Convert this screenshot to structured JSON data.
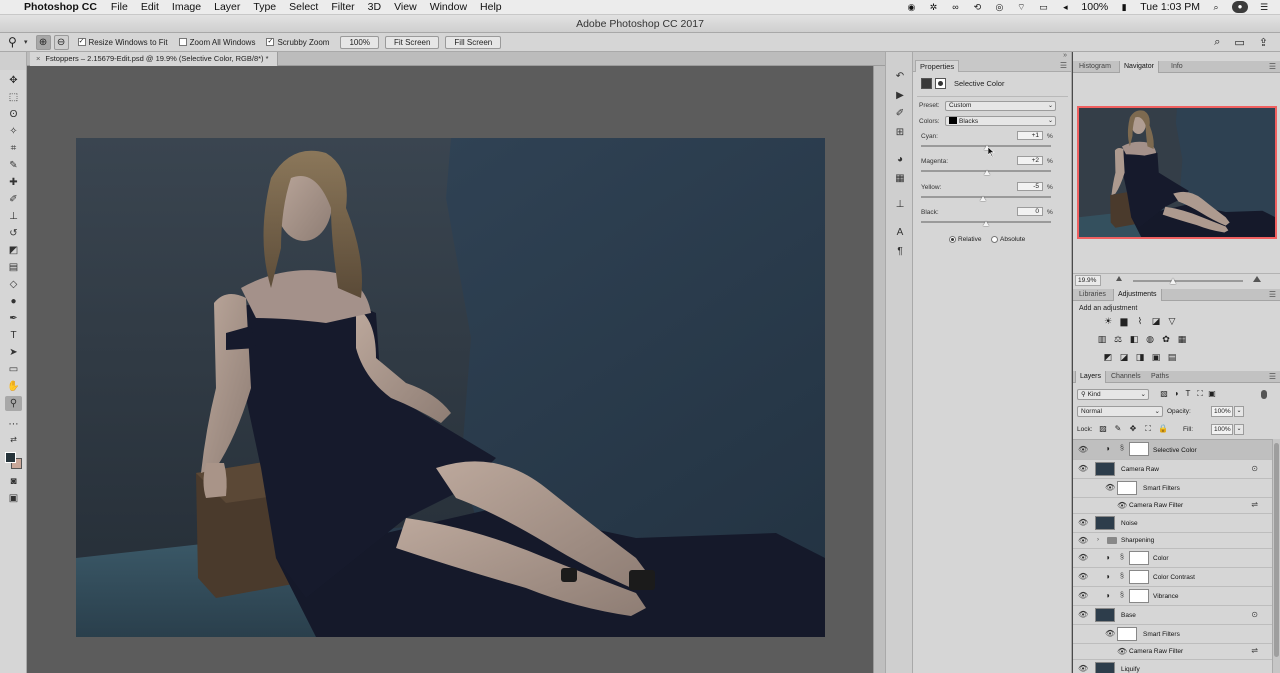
{
  "menubar": {
    "app": "Photoshop CC",
    "items": [
      "File",
      "Edit",
      "Image",
      "Layer",
      "Type",
      "Select",
      "Filter",
      "3D",
      "View",
      "Window",
      "Help"
    ],
    "battery": "100%",
    "clock": "Tue 1:03 PM"
  },
  "window": {
    "title": "Adobe Photoshop CC 2017"
  },
  "options": {
    "resize_windows": "Resize Windows to Fit",
    "zoom_all": "Zoom All Windows",
    "scrubby": "Scrubby Zoom",
    "btn_100": "100%",
    "btn_fit": "Fit Screen",
    "btn_fill": "Fill Screen"
  },
  "document": {
    "tab": "Fstoppers – 2.15679-Edit.psd @ 19.9% (Selective Color, RGB/8*) *"
  },
  "properties": {
    "tab": "Properties",
    "title": "Selective Color",
    "preset_label": "Preset:",
    "preset_value": "Custom",
    "colors_label": "Colors:",
    "colors_value": "Blacks",
    "sliders": [
      {
        "label": "Cyan:",
        "value": "+1",
        "pos": 0.505
      },
      {
        "label": "Magenta:",
        "value": "+2",
        "pos": 0.51
      },
      {
        "label": "Yellow:",
        "value": "-5",
        "pos": 0.475
      },
      {
        "label": "Black:",
        "value": "0",
        "pos": 0.5
      }
    ],
    "pct": "%",
    "relative": "Relative",
    "absolute": "Absolute"
  },
  "histogram_panel": {
    "tabs": [
      "Histogram",
      "Navigator",
      "Info"
    ],
    "zoom": "19.9%",
    "zoom_slider_pos": 0.36
  },
  "adjustments_panel": {
    "tabs": [
      "Libraries",
      "Adjustments"
    ],
    "add_label": "Add an adjustment"
  },
  "layers_panel": {
    "tabs": [
      "Layers",
      "Channels",
      "Paths"
    ],
    "kind": "Kind",
    "blend_mode": "Normal",
    "opacity_label": "Opacity:",
    "opacity": "100%",
    "lock_label": "Lock:",
    "fill_label": "Fill:",
    "fill": "100%",
    "layers": [
      {
        "name": "Selective Color"
      },
      {
        "name": "Camera Raw"
      },
      {
        "name": "Smart Filters"
      },
      {
        "name": "Camera Raw Filter"
      },
      {
        "name": "Noise"
      },
      {
        "name": "Sharpening"
      },
      {
        "name": "Color"
      },
      {
        "name": "Color Contrast"
      },
      {
        "name": "Vibrance"
      },
      {
        "name": "Base"
      },
      {
        "name": "Smart Filters"
      },
      {
        "name": "Camera Raw Filter"
      },
      {
        "name": "Liquify"
      }
    ]
  },
  "colors": {
    "accent_nav": "#f06060",
    "foreground": "#26343b",
    "background": "#c9a89a"
  }
}
